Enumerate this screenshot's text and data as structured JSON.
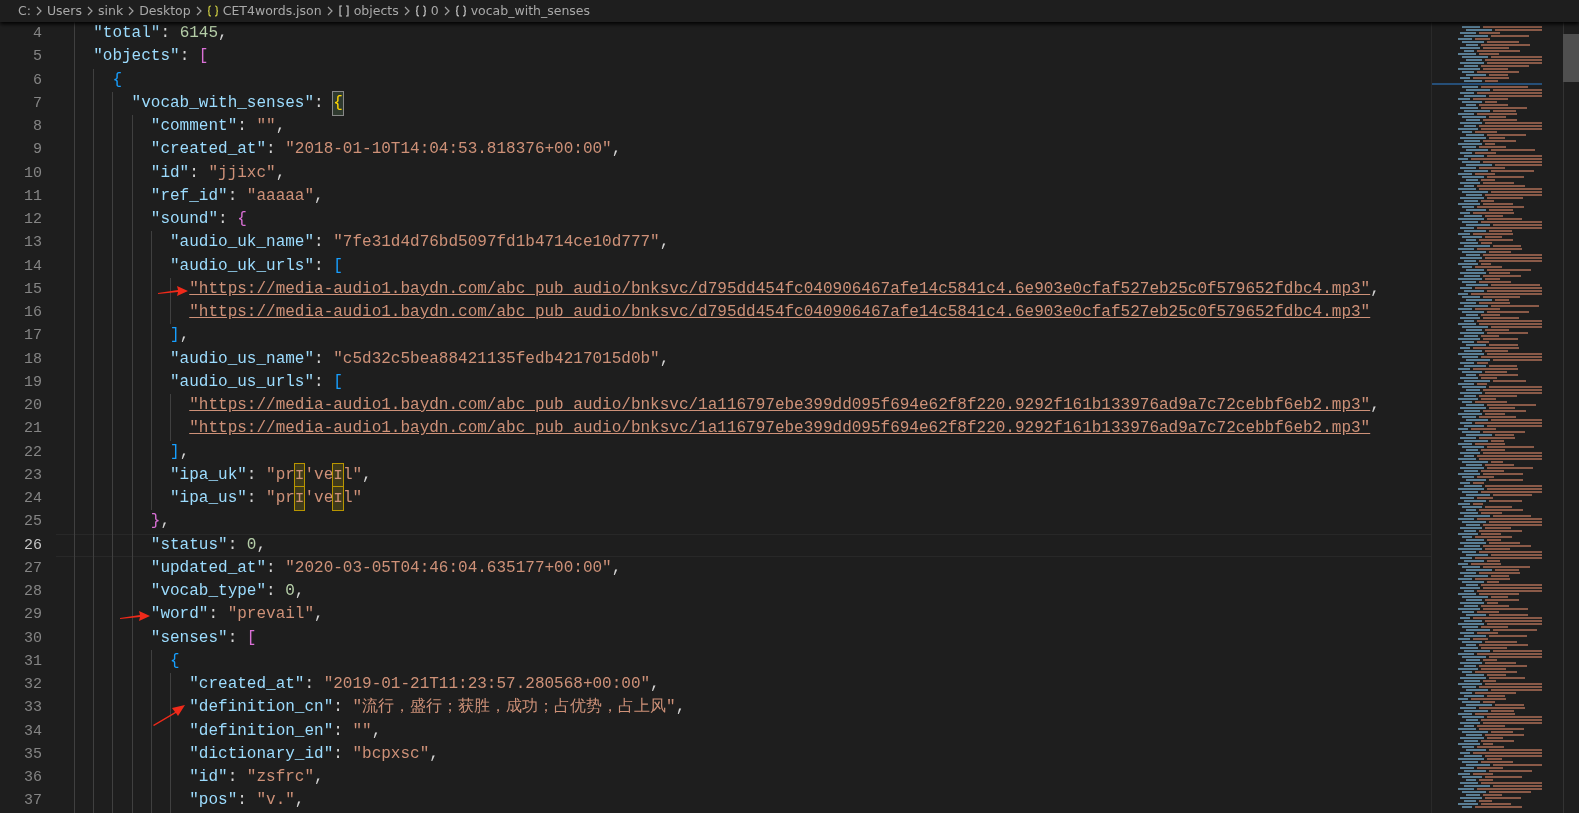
{
  "breadcrumb": [
    {
      "label": "C:",
      "kind": "folder"
    },
    {
      "label": "Users",
      "kind": "folder"
    },
    {
      "label": "sink",
      "kind": "folder"
    },
    {
      "label": "Desktop",
      "kind": "folder"
    },
    {
      "label": "CET4words.json",
      "kind": "file"
    },
    {
      "label": "objects",
      "kind": "array"
    },
    {
      "label": "0",
      "kind": "object"
    },
    {
      "label": "vocab_with_senses",
      "kind": "object"
    }
  ],
  "lines": [
    {
      "number": "4",
      "current": false,
      "tokens": [
        {
          "kind": "key",
          "text": "\"total\""
        },
        {
          "kind": "punct",
          "text": ": "
        },
        {
          "kind": "number",
          "text": "6145"
        },
        {
          "kind": "punct",
          "text": ","
        }
      ]
    },
    {
      "number": "5",
      "current": false,
      "tokens": [
        {
          "kind": "key",
          "text": "\"objects\""
        },
        {
          "kind": "punct",
          "text": ": "
        },
        {
          "kind": "opener",
          "text": "[",
          "color": "#da70d6",
          "matched": false
        }
      ]
    },
    {
      "number": "6",
      "current": false,
      "tokens": [
        {
          "kind": "opener",
          "text": "{",
          "color": "#179fff",
          "matched": false
        }
      ]
    },
    {
      "number": "7",
      "current": false,
      "tokens": [
        {
          "kind": "key",
          "text": "\"vocab_with_senses\""
        },
        {
          "kind": "punct",
          "text": ": "
        },
        {
          "kind": "opener",
          "text": "{",
          "color": "#ffd700",
          "matched": true
        }
      ]
    },
    {
      "number": "8",
      "current": false,
      "tokens": [
        {
          "kind": "key",
          "text": "\"comment\""
        },
        {
          "kind": "punct",
          "text": ": "
        },
        {
          "kind": "string",
          "text": "\"\""
        },
        {
          "kind": "punct",
          "text": ","
        }
      ]
    },
    {
      "number": "9",
      "current": false,
      "tokens": [
        {
          "kind": "key",
          "text": "\"created_at\""
        },
        {
          "kind": "punct",
          "text": ": "
        },
        {
          "kind": "string",
          "text": "\"2018-01-10T14:04:53.818376+00:00\""
        },
        {
          "kind": "punct",
          "text": ","
        }
      ]
    },
    {
      "number": "10",
      "current": false,
      "tokens": [
        {
          "kind": "key",
          "text": "\"id\""
        },
        {
          "kind": "punct",
          "text": ": "
        },
        {
          "kind": "string",
          "text": "\"jjixc\""
        },
        {
          "kind": "punct",
          "text": ","
        }
      ]
    },
    {
      "number": "11",
      "current": false,
      "tokens": [
        {
          "kind": "key",
          "text": "\"ref_id\""
        },
        {
          "kind": "punct",
          "text": ": "
        },
        {
          "kind": "string",
          "text": "\"aaaaa\""
        },
        {
          "kind": "punct",
          "text": ","
        }
      ]
    },
    {
      "number": "12",
      "current": false,
      "tokens": [
        {
          "kind": "key",
          "text": "\"sound\""
        },
        {
          "kind": "punct",
          "text": ": "
        },
        {
          "kind": "opener",
          "text": "{",
          "color": "#da70d6",
          "matched": false
        }
      ]
    },
    {
      "number": "13",
      "current": false,
      "tokens": [
        {
          "kind": "key",
          "text": "\"audio_uk_name\""
        },
        {
          "kind": "punct",
          "text": ": "
        },
        {
          "kind": "string",
          "text": "\"7fe31d4d76bd5097fd1b4714ce10d777\""
        },
        {
          "kind": "punct",
          "text": ","
        }
      ]
    },
    {
      "number": "14",
      "current": false,
      "tokens": [
        {
          "kind": "key",
          "text": "\"audio_uk_urls\""
        },
        {
          "kind": "punct",
          "text": ": "
        },
        {
          "kind": "opener",
          "text": "[",
          "color": "#179fff",
          "matched": false
        }
      ]
    },
    {
      "number": "15",
      "current": false,
      "marker": {
        "kind": "straight"
      },
      "tokens": [
        {
          "kind": "link",
          "text": "\"https://media-audio1.baydn.com/abc_pub_audio/bnksvc/d795dd454fc040906467afe14c5841c4.6e903e0cfaf527eb25c0f579652fdbc4.mp3\""
        },
        {
          "kind": "punct",
          "text": ","
        }
      ]
    },
    {
      "number": "16",
      "current": false,
      "tokens": [
        {
          "kind": "link",
          "text": "\"https://media-audio1.baydn.com/abc_pub_audio/bnksvc/d795dd454fc040906467afe14c5841c4.6e903e0cfaf527eb25c0f579652fdbc4.mp3\""
        }
      ]
    },
    {
      "number": "17",
      "current": false,
      "tokens": [
        {
          "kind": "closer",
          "text": "]",
          "color": "#179fff",
          "matched": false
        },
        {
          "kind": "punct",
          "text": ","
        }
      ]
    },
    {
      "number": "18",
      "current": false,
      "tokens": [
        {
          "kind": "key",
          "text": "\"audio_us_name\""
        },
        {
          "kind": "punct",
          "text": ": "
        },
        {
          "kind": "string",
          "text": "\"c5d32c5bea88421135fedb4217015d0b\""
        },
        {
          "kind": "punct",
          "text": ","
        }
      ]
    },
    {
      "number": "19",
      "current": false,
      "tokens": [
        {
          "kind": "key",
          "text": "\"audio_us_urls\""
        },
        {
          "kind": "punct",
          "text": ": "
        },
        {
          "kind": "opener",
          "text": "[",
          "color": "#179fff",
          "matched": false
        }
      ]
    },
    {
      "number": "20",
      "current": false,
      "tokens": [
        {
          "kind": "link",
          "text": "\"https://media-audio1.baydn.com/abc_pub_audio/bnksvc/1a116797ebe399dd095f694e62f8f220.9292f161b133976ad9a7c72cebbf6eb2.mp3\""
        },
        {
          "kind": "punct",
          "text": ","
        }
      ]
    },
    {
      "number": "21",
      "current": false,
      "tokens": [
        {
          "kind": "link",
          "text": "\"https://media-audio1.baydn.com/abc_pub_audio/bnksvc/1a116797ebe399dd095f694e62f8f220.9292f161b133976ad9a7c72cebbf6eb2.mp3\""
        }
      ]
    },
    {
      "number": "22",
      "current": false,
      "tokens": [
        {
          "kind": "closer",
          "text": "]",
          "color": "#179fff",
          "matched": false
        },
        {
          "kind": "punct",
          "text": ","
        }
      ]
    },
    {
      "number": "23",
      "current": false,
      "tokens": [
        {
          "kind": "key",
          "text": "\"ipa_uk\""
        },
        {
          "kind": "punct",
          "text": ": "
        },
        {
          "kind": "string",
          "text": "\"pr"
        },
        {
          "kind": "flagged",
          "text": "ɪ"
        },
        {
          "kind": "string",
          "text": "'ve"
        },
        {
          "kind": "flagged",
          "text": "ɪ"
        },
        {
          "kind": "string",
          "text": "l\""
        },
        {
          "kind": "punct",
          "text": ","
        }
      ]
    },
    {
      "number": "24",
      "current": false,
      "tokens": [
        {
          "kind": "key",
          "text": "\"ipa_us\""
        },
        {
          "kind": "punct",
          "text": ": "
        },
        {
          "kind": "string",
          "text": "\"pr"
        },
        {
          "kind": "flagged",
          "text": "ɪ"
        },
        {
          "kind": "string",
          "text": "'ve"
        },
        {
          "kind": "flagged",
          "text": "ɪ"
        },
        {
          "kind": "string",
          "text": "l\""
        }
      ]
    },
    {
      "number": "25",
      "current": false,
      "tokens": [
        {
          "kind": "closer",
          "text": "}",
          "color": "#da70d6",
          "matched": false
        },
        {
          "kind": "punct",
          "text": ","
        }
      ]
    },
    {
      "number": "26",
      "current": true,
      "tokens": [
        {
          "kind": "key",
          "text": "\"status\""
        },
        {
          "kind": "punct",
          "text": ": "
        },
        {
          "kind": "number",
          "text": "0"
        },
        {
          "kind": "punct",
          "text": ","
        }
      ]
    },
    {
      "number": "27",
      "current": false,
      "tokens": [
        {
          "kind": "key",
          "text": "\"updated_at\""
        },
        {
          "kind": "punct",
          "text": ": "
        },
        {
          "kind": "string",
          "text": "\"2020-03-05T04:46:04.635177+00:00\""
        },
        {
          "kind": "punct",
          "text": ","
        }
      ]
    },
    {
      "number": "28",
      "current": false,
      "tokens": [
        {
          "kind": "key",
          "text": "\"vocab_type\""
        },
        {
          "kind": "punct",
          "text": ": "
        },
        {
          "kind": "number",
          "text": "0"
        },
        {
          "kind": "punct",
          "text": ","
        }
      ]
    },
    {
      "number": "29",
      "current": false,
      "marker": {
        "kind": "straight"
      },
      "tokens": [
        {
          "kind": "key",
          "text": "\"word\""
        },
        {
          "kind": "punct",
          "text": ": "
        },
        {
          "kind": "string",
          "text": "\"prevail\""
        },
        {
          "kind": "punct",
          "text": ","
        }
      ]
    },
    {
      "number": "30",
      "current": false,
      "tokens": [
        {
          "kind": "key",
          "text": "\"senses\""
        },
        {
          "kind": "punct",
          "text": ": "
        },
        {
          "kind": "opener",
          "text": "[",
          "color": "#da70d6",
          "matched": false
        }
      ]
    },
    {
      "number": "31",
      "current": false,
      "tokens": [
        {
          "kind": "opener",
          "text": "{",
          "color": "#179fff",
          "matched": false
        }
      ]
    },
    {
      "number": "32",
      "current": false,
      "tokens": [
        {
          "kind": "key",
          "text": "\"created_at\""
        },
        {
          "kind": "punct",
          "text": ": "
        },
        {
          "kind": "string",
          "text": "\"2019-01-21T11:23:57.280568+00:00\""
        },
        {
          "kind": "punct",
          "text": ","
        }
      ]
    },
    {
      "number": "33",
      "current": false,
      "marker": {
        "kind": "slanted"
      },
      "tokens": [
        {
          "kind": "key",
          "text": "\"definition_cn\""
        },
        {
          "kind": "punct",
          "text": ": "
        },
        {
          "kind": "string",
          "text": "\"流行，盛行；获胜，成功；占优势，占上风\""
        },
        {
          "kind": "punct",
          "text": ","
        }
      ]
    },
    {
      "number": "34",
      "current": false,
      "tokens": [
        {
          "kind": "key",
          "text": "\"definition_en\""
        },
        {
          "kind": "punct",
          "text": ": "
        },
        {
          "kind": "string",
          "text": "\"\""
        },
        {
          "kind": "punct",
          "text": ","
        }
      ]
    },
    {
      "number": "35",
      "current": false,
      "tokens": [
        {
          "kind": "key",
          "text": "\"dictionary_id\""
        },
        {
          "kind": "punct",
          "text": ": "
        },
        {
          "kind": "string",
          "text": "\"bcpxsc\""
        },
        {
          "kind": "punct",
          "text": ","
        }
      ]
    },
    {
      "number": "36",
      "current": false,
      "tokens": [
        {
          "kind": "key",
          "text": "\"id\""
        },
        {
          "kind": "punct",
          "text": ": "
        },
        {
          "kind": "string",
          "text": "\"zsfrc\""
        },
        {
          "kind": "punct",
          "text": ","
        }
      ]
    },
    {
      "number": "37",
      "current": false,
      "tokens": [
        {
          "kind": "key",
          "text": "\"pos\""
        },
        {
          "kind": "punct",
          "text": ": "
        },
        {
          "kind": "string",
          "text": "\"v.\""
        },
        {
          "kind": "punct",
          "text": ","
        }
      ]
    }
  ]
}
